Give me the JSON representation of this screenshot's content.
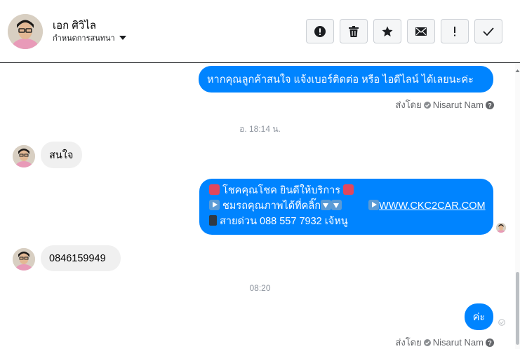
{
  "header": {
    "contact_name": "เอก ศิวิไล",
    "conversation_menu_label": "กำหนดการสนทนา",
    "toolbar": [
      {
        "icon": "alert-icon",
        "glyph": "!"
      },
      {
        "icon": "trash-icon"
      },
      {
        "icon": "star-icon"
      },
      {
        "icon": "envelope-icon"
      },
      {
        "icon": "exclamation-icon",
        "glyph": "!"
      },
      {
        "icon": "checkmark-icon"
      }
    ]
  },
  "messages": {
    "msg1": {
      "text": "หากคุณลูกค้าสนใจ แจ้งเบอร์ติดต่อ หรือ ไอดีไลน์ ได้เลยนะค่ะ"
    },
    "sent_by_1": {
      "prefix": "ส่งโดย",
      "name": "Nisarut Nam"
    },
    "time_1": "อ. 18:14 น.",
    "msg2": {
      "text": "สนใจ"
    },
    "msg3": {
      "line1": "โชคคุณโชค ยินดีให้บริการ",
      "line2": "ชมรถคุณภาพได้ที่คลิ๊ก",
      "link": "WWW.CKC2CAR.COM",
      "line3": "สายด่วน 088 557 7932 เจ้หนู"
    },
    "msg4": {
      "text": "0846159949"
    },
    "time_2": "08:20",
    "msg5": {
      "text": "ค่ะ"
    },
    "sent_by_2": {
      "prefix": "ส่งโดย",
      "name": "Nisarut Nam"
    }
  },
  "colors": {
    "outgoing_bubble": "#0084ff",
    "incoming_bubble": "#f0f0f0",
    "muted_text": "#65676b"
  }
}
